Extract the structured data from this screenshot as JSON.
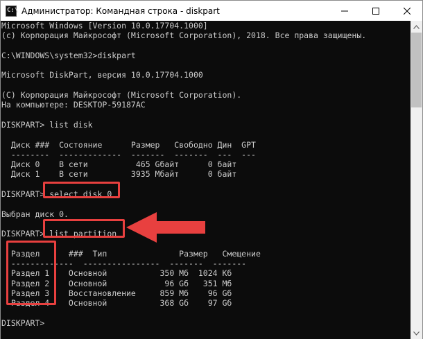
{
  "window": {
    "title": "Администратор: Командная строка - diskpart",
    "app_icon_glyph": "C:\\",
    "controls": [
      "minimize-icon",
      "maximize-icon",
      "close-icon"
    ]
  },
  "console": {
    "background": "#0c0c0c",
    "text_color": "#cccccc",
    "lines": [
      "Microsoft Windows [Version 10.0.17704.1000]",
      "(c) Корпорация Майкрософт (Microsoft Corporation), 2018. Все права защищены.",
      "",
      "C:\\WINDOWS\\system32>diskpart",
      "",
      "Microsoft DiskPart, версия 10.0.17704.1000",
      "",
      "(C) Корпорация Майкрософт (Microsoft Corporation).",
      "На компьютере: DESKTOP-59187AC",
      "",
      "DISKPART> list disk",
      "",
      "  Диск ###  Состояние      Размер   Свободно Дин  GPT",
      "  --------  -------------  -------  -------  ---  ---",
      "  Диск 0    В сети          465 Gбайт      0 байт",
      "  Диск 1    В сети         3935 Mбайт      0 байт",
      "",
      "DISKPART> select disk 0",
      "",
      "Выбран диск 0.",
      "",
      "DISKPART> list partition",
      "",
      "  Раздел      ###  Тип               Размер   Смещение",
      "  -------------  ----------------  -------  -------",
      "  Раздел 1    Основной           350 Мб  1024 Кб",
      "  Раздел 2    Основной            96 Gб   351 Мб",
      "  Раздел 3    Восстановление     859 Мб    96 Gб",
      "  Раздел 4    Основной           368 Gб    97 Gб",
      "",
      "DISKPART>"
    ]
  },
  "annotations": {
    "highlight_color": "#e8403f",
    "boxes": [
      "select-disk-command-highlight",
      "list-partition-command-highlight",
      "partition-names-highlight"
    ],
    "arrow": "left-pointing-arrow"
  }
}
